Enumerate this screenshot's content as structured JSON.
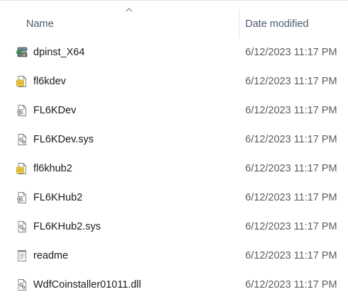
{
  "columns": {
    "name": "Name",
    "date_modified": "Date modified"
  },
  "sort": {
    "column": "name",
    "direction": "ascending",
    "icon": "sort-up-arrow-icon"
  },
  "files": [
    {
      "name": "dpinst_X64",
      "date": "6/12/2023 11:17 PM",
      "icon": "installer-app-icon"
    },
    {
      "name": "fl6kdev",
      "date": "6/12/2023 11:17 PM",
      "icon": "setup-information-icon"
    },
    {
      "name": "FL6KDev",
      "date": "6/12/2023 11:17 PM",
      "icon": "catalog-file-icon"
    },
    {
      "name": "FL6KDev.sys",
      "date": "6/12/2023 11:17 PM",
      "icon": "system-file-icon"
    },
    {
      "name": "fl6khub2",
      "date": "6/12/2023 11:17 PM",
      "icon": "setup-information-icon"
    },
    {
      "name": "FL6KHub2",
      "date": "6/12/2023 11:17 PM",
      "icon": "catalog-file-icon"
    },
    {
      "name": "FL6KHub2.sys",
      "date": "6/12/2023 11:17 PM",
      "icon": "system-file-icon"
    },
    {
      "name": "readme",
      "date": "6/12/2023 11:17 PM",
      "icon": "text-document-icon"
    },
    {
      "name": "WdfCoinstaller01011.dll",
      "date": "6/12/2023 11:17 PM",
      "icon": "system-file-icon"
    }
  ],
  "colors": {
    "header_text": "#4c5a73",
    "name_text": "#1b1b1b",
    "date_text": "#5d5d5d",
    "divider": "#e5e5e5"
  }
}
